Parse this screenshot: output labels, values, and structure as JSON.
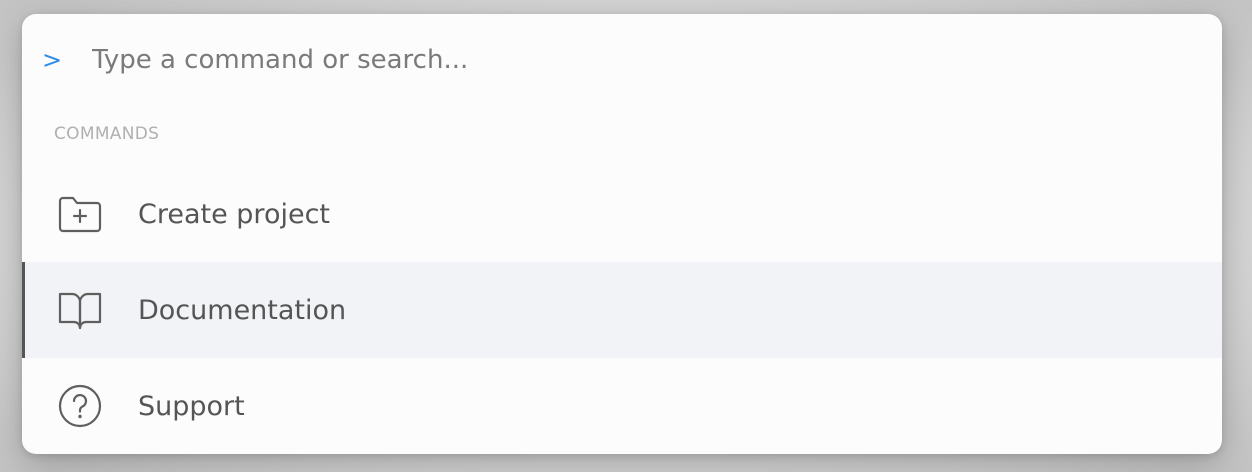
{
  "search": {
    "prompt_symbol": ">",
    "placeholder": "Type a command or search...",
    "value": ""
  },
  "commands": {
    "section_title": "COMMANDS",
    "items": [
      {
        "label": "Create project",
        "icon": "folder-plus-icon"
      },
      {
        "label": "Documentation",
        "icon": "book-open-icon",
        "active": true
      },
      {
        "label": "Support",
        "icon": "help-circle-icon"
      }
    ]
  },
  "colors": {
    "accent": "#2b8be8",
    "active_bg": "#f2f3f6",
    "active_indicator": "#555555",
    "text": "#555555",
    "section_header": "#b0b0b0"
  }
}
